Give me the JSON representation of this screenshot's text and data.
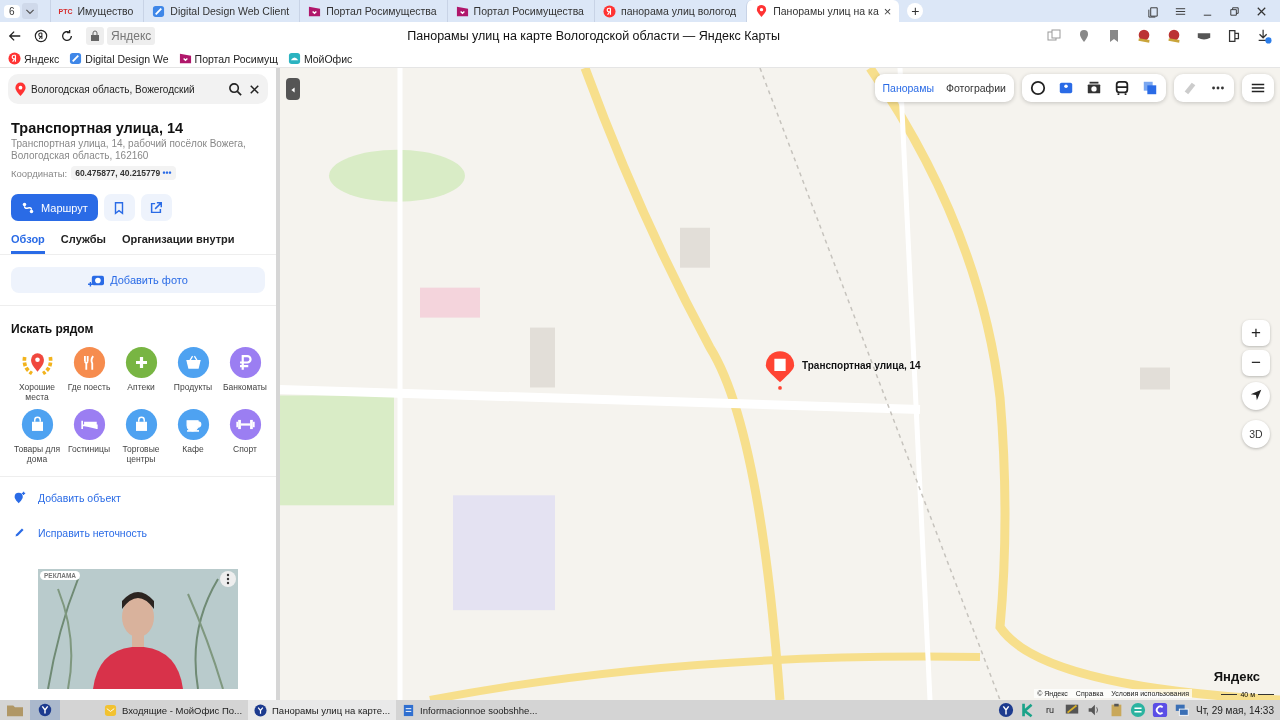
{
  "browser": {
    "tab_count": "6",
    "tabs": [
      {
        "label": "Имущество",
        "favicon_text": "РТС",
        "selected": false
      },
      {
        "label": "Digital Design Web Client",
        "selected": false
      },
      {
        "label": "Портал Росимущества",
        "selected": false
      },
      {
        "label": "Портал Росимущества",
        "selected": false
      },
      {
        "label": "панорама улиц вологод",
        "selected": false
      },
      {
        "label": "Панорамы улиц на ка",
        "selected": true
      }
    ],
    "close_glyph": "×",
    "new_tab_glyph": "+",
    "address": "Яндекс",
    "page_title": "Панорамы улиц на карте Вологодской области — Яндекс Карты",
    "bookmarks": [
      {
        "label": "Яндекс"
      },
      {
        "label": "Digital Design We"
      },
      {
        "label": "Портал Росимущ"
      },
      {
        "label": "МойОфис"
      }
    ]
  },
  "sidebar": {
    "search": {
      "value": "Вологодская область, Вожегодский"
    },
    "place": {
      "title": "Транспортная улица, 14",
      "address": "Транспортная улица, 14, рабочий посёлок Вожега, Вологодская область, 162160",
      "coords_label": "Координаты:",
      "coords": "60.475877, 40.215779",
      "more": "•••"
    },
    "route_button": "Маршрут",
    "tabs": [
      {
        "label": "Обзор",
        "selected": true
      },
      {
        "label": "Службы",
        "selected": false
      },
      {
        "label": "Организации внутри",
        "selected": false
      }
    ],
    "add_photo": "Добавить фото",
    "nearby_title": "Искать рядом",
    "nearby": [
      {
        "label": "Хорошие места",
        "kind": "laurel",
        "color": "#f0483e"
      },
      {
        "label": "Где поесть",
        "kind": "food",
        "color": "#f68c4e"
      },
      {
        "label": "Аптеки",
        "kind": "plus",
        "color": "#78b543"
      },
      {
        "label": "Продукты",
        "kind": "basket",
        "color": "#4ea2f1"
      },
      {
        "label": "Банкоматы",
        "kind": "ruble",
        "color": "#9b7ef2"
      },
      {
        "label": "Товары для дома",
        "kind": "bag",
        "color": "#4ea2f1"
      },
      {
        "label": "Гостиницы",
        "kind": "bed",
        "color": "#9b7ef2"
      },
      {
        "label": "Торговые центры",
        "kind": "bag",
        "color": "#4ea2f1"
      },
      {
        "label": "Кафе",
        "kind": "cup",
        "color": "#4ea2f1"
      },
      {
        "label": "Спорт",
        "kind": "dumbbell",
        "color": "#9b7ef2"
      }
    ],
    "actions": [
      {
        "label": "Добавить объект",
        "kind": "add-place"
      },
      {
        "label": "Исправить неточность",
        "kind": "edit"
      }
    ],
    "ad": {
      "badge": "РЕКЛАМА",
      "kind": "picture"
    }
  },
  "map": {
    "mode_tabs": [
      {
        "label": "Панорамы",
        "selected": true
      },
      {
        "label": "Фотографии",
        "selected": false
      }
    ],
    "pin_label": "Транспортная улица, 14",
    "zoom_in": "+",
    "zoom_out": "−",
    "view_3d": "3D",
    "attribution": [
      "© Яндекс",
      "Справка",
      "Условия использования"
    ],
    "scale": "40 м",
    "logo": "Яндекс"
  },
  "taskbar": {
    "windows": [
      {
        "label": "Входящие - МойОфис По...",
        "selected": false
      },
      {
        "label": "Панорамы улиц на карте...",
        "selected": true
      },
      {
        "label": "Informacionnoe soobshhe...",
        "selected": false
      }
    ],
    "lang": "ru",
    "clock": "Чт, 29 мая, 14:33"
  }
}
